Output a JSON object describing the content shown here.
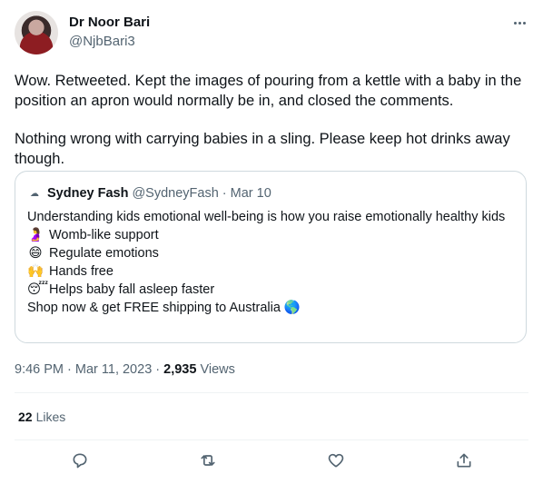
{
  "author": {
    "name": "Dr Noor Bari",
    "handle": "@NjbBari3"
  },
  "tweet": {
    "paragraphs": [
      "Wow. Retweeted. Kept the images of pouring from a kettle with a baby in the position an apron would normally be in, and closed the comments.",
      "Nothing wrong with carrying babies in a sling. Please keep hot drinks away though."
    ]
  },
  "quote": {
    "name": "Sydney Fash",
    "handle": "@SydneyFash",
    "separator": "·",
    "date": "Mar 10",
    "intro": "Understanding kids emotional well-being is how you raise emotionally healthy kids",
    "items": [
      {
        "emoji": "🤰",
        "text": "Womb-like support"
      },
      {
        "emoji": "😄",
        "text": "Regulate emotions"
      },
      {
        "emoji": "🙌",
        "text": "Hands free"
      },
      {
        "emoji": "😴",
        "text": "Helps baby fall asleep faster"
      }
    ],
    "outro": "Shop now & get FREE shipping to Australia",
    "outro_emoji": "🌎"
  },
  "meta": {
    "time": "9:46 PM · Mar 11, 2023 · ",
    "views_count": "2,935",
    "views_label": "Views"
  },
  "stats": {
    "likes_count": "22",
    "likes_label": "Likes"
  },
  "icons": [
    "reply-icon",
    "retweet-icon",
    "like-icon",
    "share-icon",
    "more-icon"
  ],
  "colors": {
    "text": "#0f1419",
    "muted": "#536471",
    "border": "#cfd9de"
  }
}
